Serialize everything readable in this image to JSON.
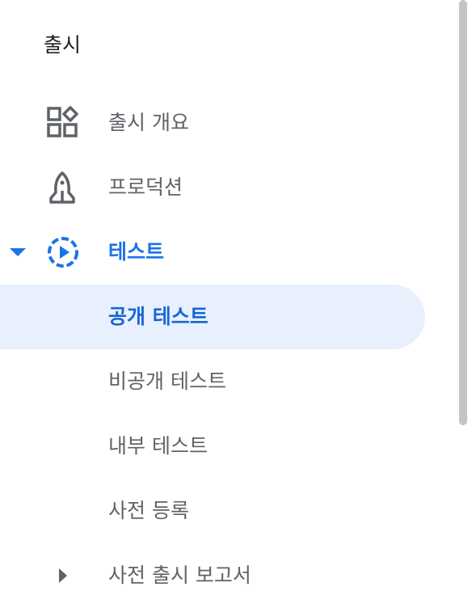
{
  "nav": {
    "section_title": "출시",
    "items": [
      {
        "label": "출시 개요",
        "icon": "dashboard-shapes-icon"
      },
      {
        "label": "프로덕션",
        "icon": "rocket-icon"
      },
      {
        "label": "테스트",
        "icon": "testing-play-icon",
        "expanded": true,
        "active": true
      },
      {
        "label": "공개 테스트",
        "selected": true
      },
      {
        "label": "비공개 테스트"
      },
      {
        "label": "내부 테스트"
      },
      {
        "label": "사전 등록"
      },
      {
        "label": "사전 출시 보고서",
        "expanded": false
      }
    ]
  },
  "colors": {
    "accent": "#1a73e8",
    "selected_bg": "#e8f0fe",
    "text": "#5f6368",
    "title": "#202124"
  }
}
